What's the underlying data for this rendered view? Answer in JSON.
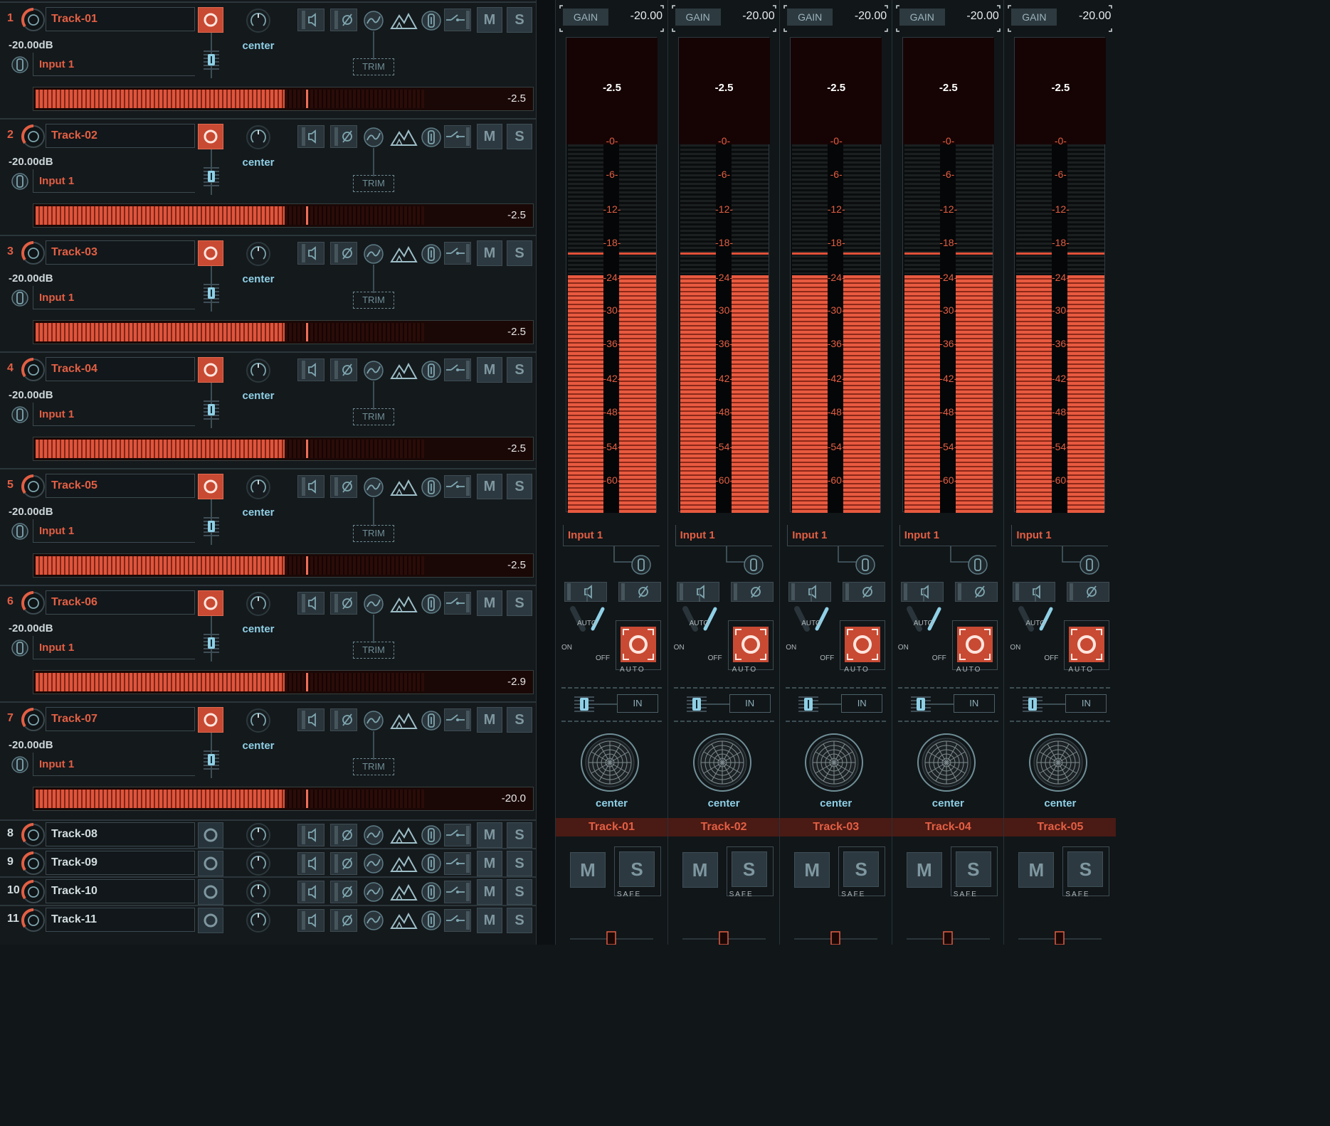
{
  "colors": {
    "accent": "#e35f44",
    "text_cyan": "#8fd0e6",
    "panel": "#14191c",
    "button": "#2d3940"
  },
  "tracks": [
    {
      "num": "1",
      "name": "Track-01",
      "gain": "-20.00dB",
      "input": "Input 1",
      "pan": "center",
      "trim": "TRIM",
      "mute": "M",
      "solo": "S",
      "meter": "-2.5"
    },
    {
      "num": "2",
      "name": "Track-02",
      "gain": "-20.00dB",
      "input": "Input 1",
      "pan": "center",
      "trim": "TRIM",
      "mute": "M",
      "solo": "S",
      "meter": "-2.5"
    },
    {
      "num": "3",
      "name": "Track-03",
      "gain": "-20.00dB",
      "input": "Input 1",
      "pan": "center",
      "trim": "TRIM",
      "mute": "M",
      "solo": "S",
      "meter": "-2.5"
    },
    {
      "num": "4",
      "name": "Track-04",
      "gain": "-20.00dB",
      "input": "Input 1",
      "pan": "center",
      "trim": "TRIM",
      "mute": "M",
      "solo": "S",
      "meter": "-2.5"
    },
    {
      "num": "5",
      "name": "Track-05",
      "gain": "-20.00dB",
      "input": "Input 1",
      "pan": "center",
      "trim": "TRIM",
      "mute": "M",
      "solo": "S",
      "meter": "-2.5"
    },
    {
      "num": "6",
      "name": "Track-06",
      "gain": "-20.00dB",
      "input": "Input 1",
      "pan": "center",
      "trim": "TRIM",
      "mute": "M",
      "solo": "S",
      "meter": "-2.9"
    },
    {
      "num": "7",
      "name": "Track-07",
      "gain": "-20.00dB",
      "input": "Input 1",
      "pan": "center",
      "trim": "TRIM",
      "mute": "M",
      "solo": "S",
      "meter": "-20.0"
    }
  ],
  "collapsed_tracks": [
    {
      "num": "8",
      "name": "Track-08",
      "mute": "M",
      "solo": "S"
    },
    {
      "num": "9",
      "name": "Track-09",
      "mute": "M",
      "solo": "S"
    },
    {
      "num": "10",
      "name": "Track-10",
      "mute": "M",
      "solo": "S"
    },
    {
      "num": "11",
      "name": "Track-11",
      "mute": "M",
      "solo": "S"
    }
  ],
  "strips": [
    {
      "gain_label": "GAIN",
      "gain_value": "-20.00",
      "peak": "-2.5",
      "input": "Input 1",
      "auto": "AUTO",
      "on": "ON",
      "off": "OFF",
      "auto_btn": "AUTO",
      "in_btn": "IN",
      "pan": "center",
      "name": "Track-01",
      "mute": "M",
      "solo": "S",
      "safe": "SAFE"
    },
    {
      "gain_label": "GAIN",
      "gain_value": "-20.00",
      "peak": "-2.5",
      "input": "Input 1",
      "auto": "AUTO",
      "on": "ON",
      "off": "OFF",
      "auto_btn": "AUTO",
      "in_btn": "IN",
      "pan": "center",
      "name": "Track-02",
      "mute": "M",
      "solo": "S",
      "safe": "SAFE"
    },
    {
      "gain_label": "GAIN",
      "gain_value": "-20.00",
      "peak": "-2.5",
      "input": "Input 1",
      "auto": "AUTO",
      "on": "ON",
      "off": "OFF",
      "auto_btn": "AUTO",
      "in_btn": "IN",
      "pan": "center",
      "name": "Track-03",
      "mute": "M",
      "solo": "S",
      "safe": "SAFE"
    },
    {
      "gain_label": "GAIN",
      "gain_value": "-20.00",
      "peak": "-2.5",
      "input": "Input 1",
      "auto": "AUTO",
      "on": "ON",
      "off": "OFF",
      "auto_btn": "AUTO",
      "in_btn": "IN",
      "pan": "center",
      "name": "Track-04",
      "mute": "M",
      "solo": "S",
      "safe": "SAFE"
    },
    {
      "gain_label": "GAIN",
      "gain_value": "-20.00",
      "peak": "-2.5",
      "input": "Input 1",
      "auto": "AUTO",
      "on": "ON",
      "off": "OFF",
      "auto_btn": "AUTO",
      "in_btn": "IN",
      "pan": "center",
      "name": "Track-05",
      "mute": "M",
      "solo": "S",
      "safe": "SAFE"
    }
  ],
  "meter_scale": [
    "-0-",
    "-6-",
    "-12-",
    "-18-",
    "-24-",
    "-30-",
    "-36-",
    "-42-",
    "-48-",
    "-54-",
    "-60-"
  ],
  "icons": [
    "track-knob-icon",
    "record-icon",
    "pan-knob-icon",
    "speaker-icon",
    "phase-icon",
    "eq-curve-icon",
    "dynamics-icon",
    "input-trim-icon",
    "route-icon",
    "fader-icon",
    "surround-panner-icon"
  ]
}
